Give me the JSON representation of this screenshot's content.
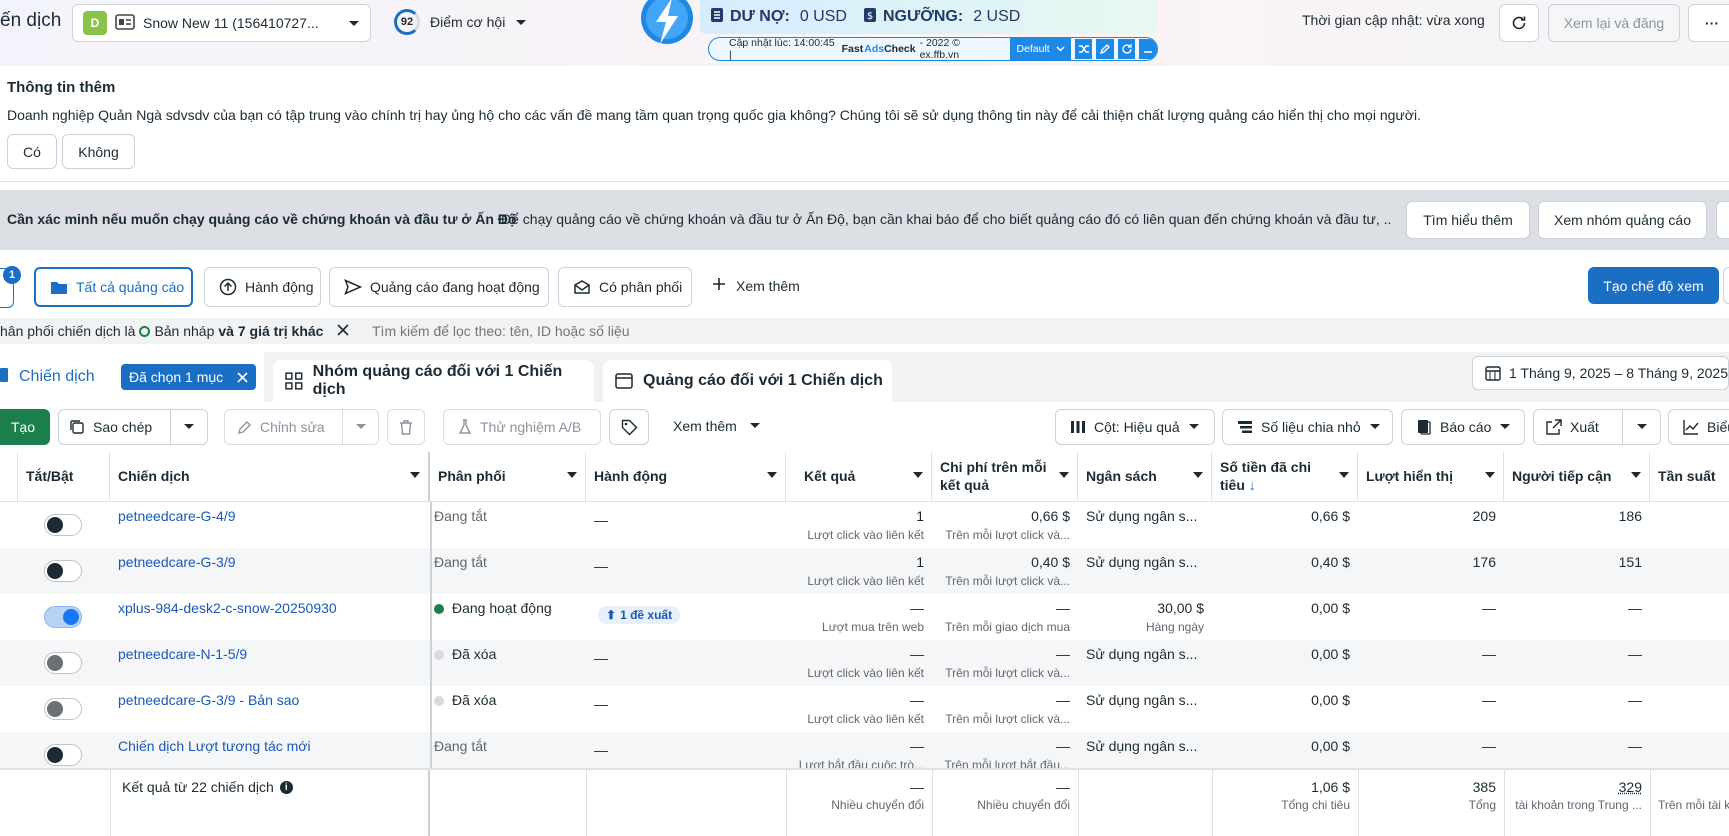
{
  "top": {
    "title_fragment": "ến dịch",
    "account_badge": "D",
    "account_name": "Snow New 11 (156410727...",
    "score": "92",
    "score_label": "Điểm cơ hội",
    "update_label": "Thời gian cập nhật: vừa xong",
    "review_button": "Xem lại và đăng",
    "more_button": "···"
  },
  "adscheck": {
    "debt_label": "DƯ NỢ:",
    "debt_value": "0 USD",
    "threshold_label": "NGƯỠNG:",
    "threshold_value": "2 USD",
    "updated_at": "Cập nhật lúc: 14:00:45 |",
    "brand_fast": "Fast",
    "brand_ads": "Ads",
    "brand_check": "Check",
    "copyright": "- 2022 © ex.ffb.vn",
    "preset": "Default"
  },
  "info": {
    "title": "Thông tin thêm",
    "body": "Doanh nghiệp Quản Ngà sdvsdv của bạn có tập trung vào chính trị hay ủng hộ cho các vấn đề mang tầm quan trọng quốc gia không? Chúng tôi sẽ sử dụng thông tin này để cải thiện chất lượng quảng cáo hiển thị cho mọi người.",
    "yes": "Có",
    "no": "Không"
  },
  "notice": {
    "title": "Cần xác minh nếu muốn chạy quảng cáo về chứng khoán và đầu tư ở Ấn Độ",
    "body": "Để chạy quảng cáo về chứng khoán và đầu tư ở Ấn Độ, bạn cần khai báo để cho biết quảng cáo đó có liên quan đến chứng khoán và đầu tư, ...",
    "learn_more": "Tìm hiểu thêm",
    "view_groups": "Xem nhóm quảng cáo"
  },
  "filters": {
    "search_badge": "1",
    "all_ads": "Tất cả quảng cáo",
    "actions": "Hành động",
    "active_ads": "Quảng cáo đang hoạt động",
    "delivery": "Có phân phối",
    "see_more": "Xem thêm",
    "create_view": "Tạo chế độ xem"
  },
  "chips": {
    "chip_prefix": "hân phối chiến dịch là",
    "chip_draft": "Bản nháp",
    "chip_more": "và 7 giá trị khác",
    "search_placeholder": "Tìm kiếm để lọc theo: tên, ID hoặc số liệu"
  },
  "tabs": {
    "campaign": "Chiến dịch",
    "selected": "Đã chọn 1 mục",
    "adsets": "Nhóm quảng cáo đối với 1 Chiến dịch",
    "ads": "Quảng cáo đối với 1 Chiến dịch",
    "date_range": "1 Tháng 9, 2025 – 8 Tháng 9, 2025"
  },
  "toolbar": {
    "create": "Tạo",
    "copy": "Sao chép",
    "edit": "Chỉnh sửa",
    "ab_test": "Thử nghiệm A/B",
    "see_more": "Xem thêm",
    "columns": "Cột: Hiệu quả",
    "breakdown": "Số liệu chia nhỏ",
    "reports": "Báo cáo",
    "export": "Xuất",
    "charts": "Biểu"
  },
  "table": {
    "headers": {
      "toggle": "Tắt/Bật",
      "campaign": "Chiến dịch",
      "delivery": "Phân phối",
      "actions": "Hành động",
      "results": "Kết quả",
      "cpr_1": "Chi phí trên mỗi",
      "cpr_2": "kết quả",
      "budget": "Ngân sách",
      "spent_1": "Số tiền đã chi",
      "spent_2": "tiêu",
      "impressions": "Lượt hiển thị",
      "reach": "Người tiếp cận",
      "frequency": "Tần suất"
    },
    "rows": [
      {
        "name": "petneedcare-G-4/9",
        "status": "Đang tắt",
        "action": "—",
        "result": "1",
        "result_sub": "Lượt click vào liên kết",
        "cpr": "0,66 $",
        "cpr_sub": "Trên mỗi lượt click và...",
        "budget": "Sử dụng ngân s...",
        "budget_sub": "",
        "spent": "0,66 $",
        "impr": "209",
        "reach": "186"
      },
      {
        "name": "petneedcare-G-3/9",
        "status": "Đang tắt",
        "action": "—",
        "result": "1",
        "result_sub": "Lượt click vào liên kết",
        "cpr": "0,40 $",
        "cpr_sub": "Trên mỗi lượt click và...",
        "budget": "Sử dụng ngân s...",
        "budget_sub": "",
        "spent": "0,40 $",
        "impr": "176",
        "reach": "151"
      },
      {
        "name": "xplus-984-desk2-c-snow-20250930",
        "status": "Đang hoạt động",
        "action": "1 đề xuất",
        "result": "—",
        "result_sub": "Lượt mua trên web",
        "cpr": "—",
        "cpr_sub": "Trên mỗi giao dịch mua",
        "budget": "30,00 $",
        "budget_sub": "Hàng ngày",
        "spent": "0,00 $",
        "impr": "—",
        "reach": "—"
      },
      {
        "name": "petneedcare-N-1-5/9",
        "status": "Đã xóa",
        "action": "—",
        "result": "—",
        "result_sub": "Lượt click vào liên kết",
        "cpr": "—",
        "cpr_sub": "Trên mỗi lượt click và...",
        "budget": "Sử dụng ngân s...",
        "budget_sub": "",
        "spent": "0,00 $",
        "impr": "—",
        "reach": "—"
      },
      {
        "name": "petneedcare-G-3/9 - Bản sao",
        "status": "Đã xóa",
        "action": "—",
        "result": "—",
        "result_sub": "Lượt click vào liên kết",
        "cpr": "—",
        "cpr_sub": "Trên mỗi lượt click và...",
        "budget": "Sử dụng ngân s...",
        "budget_sub": "",
        "spent": "0,00 $",
        "impr": "—",
        "reach": "—"
      },
      {
        "name": "Chiến dịch Lượt tương tác mới",
        "status": "Đang tắt",
        "action": "—",
        "result": "—",
        "result_sub": "Lượt bắt đầu cuộc trò...",
        "cpr": "—",
        "cpr_sub": "Trên mỗi lượt bắt đầu...",
        "budget": "Sử dụng ngân s...",
        "budget_sub": "",
        "spent": "0,00 $",
        "impr": "—",
        "reach": "—"
      }
    ],
    "footer": {
      "label": "Kết quả từ 22 chiến dịch",
      "result": "—",
      "result_sub": "Nhiều chuyển đổi",
      "cpr": "—",
      "cpr_sub": "Nhiều chuyển đổi",
      "spent": "1,06 $",
      "spent_sub": "Tổng chi tiêu",
      "impr": "385",
      "impr_sub": "Tổng",
      "reach": "329",
      "reach_sub": "tài khoản trong Trung ...",
      "freq_sub": "Trên mỗi tài k"
    }
  },
  "colors": {
    "primary": "#1a6fc4",
    "accent_green": "#1a7f4b",
    "link": "#1a59b5"
  }
}
